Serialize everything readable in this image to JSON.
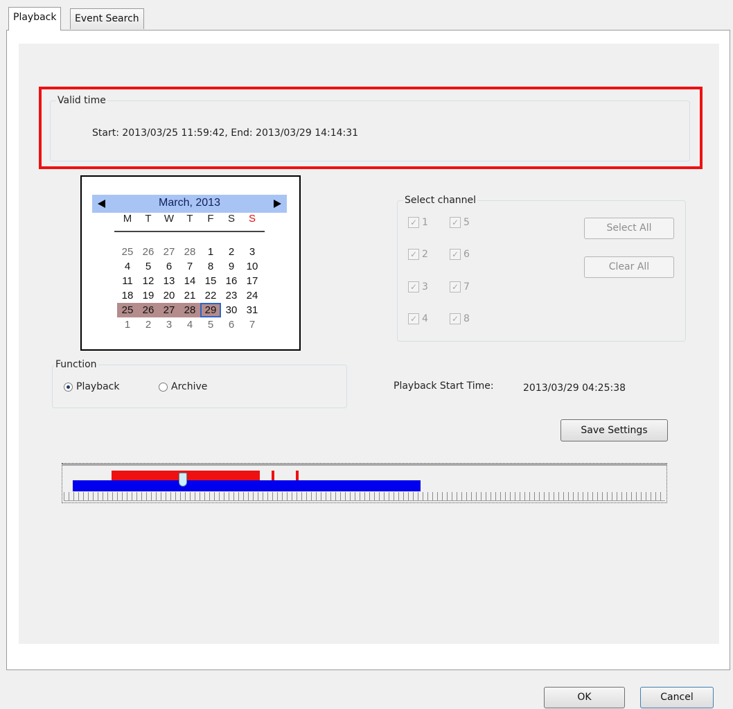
{
  "tabs": [
    {
      "label": "Playback",
      "active": true
    },
    {
      "label": "Event Search",
      "active": false
    }
  ],
  "valid_time": {
    "label": "Valid time",
    "text": "Start: 2013/03/25 11:59:42,  End: 2013/03/29 14:14:31",
    "highlight_color": "#ee1111"
  },
  "calendar": {
    "month_label": "March, 2013",
    "prev_icon": "triangle-left",
    "next_icon": "triangle-right",
    "weekdays": [
      "M",
      "T",
      "W",
      "T",
      "F",
      "S",
      "S"
    ],
    "sunday_color": "#e01010",
    "header_color": "#a8c4f5",
    "recorded_day_color": "#b48c8c",
    "selected_border_color": "#2d64c8",
    "weeks": [
      [
        {
          "d": "25",
          "o": true
        },
        {
          "d": "26",
          "o": true
        },
        {
          "d": "27",
          "o": true
        },
        {
          "d": "28",
          "o": true
        },
        {
          "d": "1"
        },
        {
          "d": "2"
        },
        {
          "d": "3"
        }
      ],
      [
        {
          "d": "4"
        },
        {
          "d": "5"
        },
        {
          "d": "6"
        },
        {
          "d": "7"
        },
        {
          "d": "8"
        },
        {
          "d": "9"
        },
        {
          "d": "10"
        }
      ],
      [
        {
          "d": "11"
        },
        {
          "d": "12"
        },
        {
          "d": "13"
        },
        {
          "d": "14"
        },
        {
          "d": "15"
        },
        {
          "d": "16"
        },
        {
          "d": "17"
        }
      ],
      [
        {
          "d": "18"
        },
        {
          "d": "19"
        },
        {
          "d": "20"
        },
        {
          "d": "21"
        },
        {
          "d": "22"
        },
        {
          "d": "23"
        },
        {
          "d": "24"
        }
      ],
      [
        {
          "d": "25",
          "r": true
        },
        {
          "d": "26",
          "r": true
        },
        {
          "d": "27",
          "r": true
        },
        {
          "d": "28",
          "r": true
        },
        {
          "d": "29",
          "r": true,
          "s": true
        },
        {
          "d": "30"
        },
        {
          "d": "31"
        }
      ],
      [
        {
          "d": "1",
          "o": true
        },
        {
          "d": "2",
          "o": true
        },
        {
          "d": "3",
          "o": true
        },
        {
          "d": "4",
          "o": true
        },
        {
          "d": "5",
          "o": true
        },
        {
          "d": "6",
          "o": true
        },
        {
          "d": "7",
          "o": true
        }
      ]
    ]
  },
  "select_channel": {
    "label": "Select channel",
    "channels": [
      {
        "label": "1",
        "checked": true
      },
      {
        "label": "2",
        "checked": true
      },
      {
        "label": "3",
        "checked": true
      },
      {
        "label": "4",
        "checked": true
      },
      {
        "label": "5",
        "checked": true
      },
      {
        "label": "6",
        "checked": true
      },
      {
        "label": "7",
        "checked": true
      },
      {
        "label": "8",
        "checked": true
      }
    ],
    "select_all_label": "Select All",
    "clear_all_label": "Clear All"
  },
  "function": {
    "label": "Function",
    "options": [
      {
        "label": "Playback",
        "selected": true
      },
      {
        "label": "Archive",
        "selected": false
      }
    ]
  },
  "playback_start": {
    "label": "Playback Start Time:",
    "value": "2013/03/29 04:25:38"
  },
  "save_settings_label": "Save Settings",
  "timeline": {
    "recording_color": "#ee1111",
    "available_color": "#0000ee",
    "handle_color": "#cdeff7"
  },
  "footer": {
    "ok_label": "OK",
    "cancel_label": "Cancel"
  }
}
